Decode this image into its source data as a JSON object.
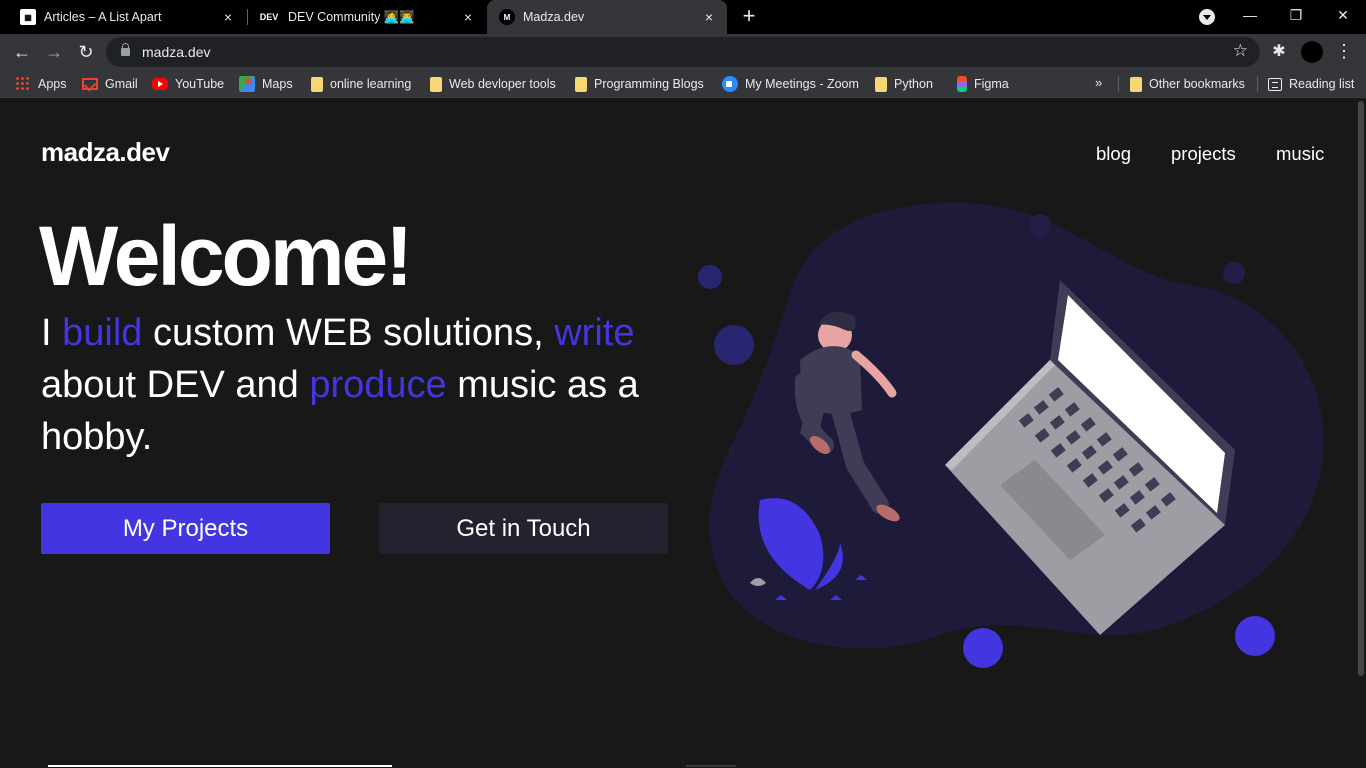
{
  "browser": {
    "tabs": [
      {
        "title": "Articles – A List Apart",
        "favicon": "ala-icon",
        "close": "×"
      },
      {
        "title": "DEV Community 👩‍💻👨‍💻",
        "favicon": "DEV",
        "close": "×"
      },
      {
        "title": "Madza.dev",
        "favicon": "M",
        "close": "×"
      }
    ],
    "new_tab": "+",
    "address": "madza.dev",
    "bookmarks": [
      {
        "label": "Apps",
        "icon": "apps-icon"
      },
      {
        "label": "Gmail",
        "icon": "gmail-icon"
      },
      {
        "label": "YouTube",
        "icon": "youtube-icon"
      },
      {
        "label": "Maps",
        "icon": "maps-icon"
      },
      {
        "label": "online learning",
        "icon": "folder-icon"
      },
      {
        "label": "Web devloper tools",
        "icon": "folder-icon"
      },
      {
        "label": "Programming Blogs",
        "icon": "folder-icon"
      },
      {
        "label": "My Meetings - Zoom",
        "icon": "zoom-icon"
      },
      {
        "label": "Python",
        "icon": "folder-icon"
      },
      {
        "label": "Figma",
        "icon": "figma-icon"
      }
    ],
    "bookmarks_more": "»",
    "other_bookmarks": "Other bookmarks",
    "reading_list": "Reading list"
  },
  "site": {
    "logo": "madza.dev",
    "nav": [
      "blog",
      "projects",
      "music"
    ],
    "hero": {
      "title": "Welcome!",
      "line_parts": [
        "I ",
        "build",
        " custom WEB solutions, ",
        "write",
        " about DEV and ",
        "produce",
        " music as a hobby."
      ]
    },
    "buttons": {
      "primary": "My Projects",
      "secondary": "Get in Touch"
    }
  },
  "colors": {
    "accent": "#4335e0",
    "page_bg": "#181818",
    "secondary_button": "#23222e",
    "blob": "#1d1a3a"
  }
}
